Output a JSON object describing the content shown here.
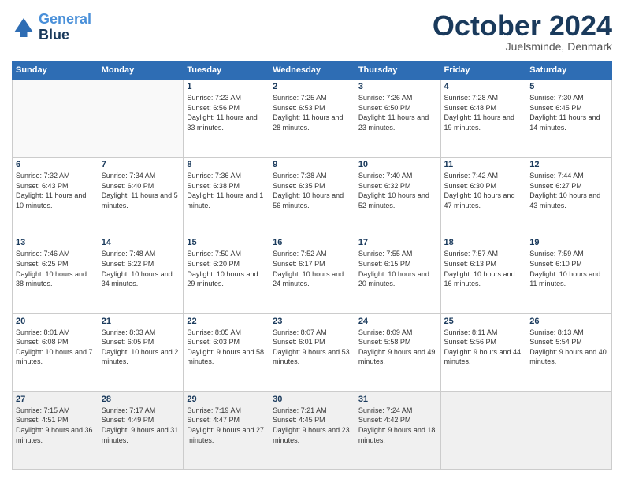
{
  "logo": {
    "line1": "General",
    "line2": "Blue"
  },
  "header": {
    "month": "October 2024",
    "location": "Juelsminde, Denmark"
  },
  "weekdays": [
    "Sunday",
    "Monday",
    "Tuesday",
    "Wednesday",
    "Thursday",
    "Friday",
    "Saturday"
  ],
  "weeks": [
    [
      {
        "day": "",
        "sunrise": "",
        "sunset": "",
        "daylight": ""
      },
      {
        "day": "",
        "sunrise": "",
        "sunset": "",
        "daylight": ""
      },
      {
        "day": "1",
        "sunrise": "Sunrise: 7:23 AM",
        "sunset": "Sunset: 6:56 PM",
        "daylight": "Daylight: 11 hours and 33 minutes."
      },
      {
        "day": "2",
        "sunrise": "Sunrise: 7:25 AM",
        "sunset": "Sunset: 6:53 PM",
        "daylight": "Daylight: 11 hours and 28 minutes."
      },
      {
        "day": "3",
        "sunrise": "Sunrise: 7:26 AM",
        "sunset": "Sunset: 6:50 PM",
        "daylight": "Daylight: 11 hours and 23 minutes."
      },
      {
        "day": "4",
        "sunrise": "Sunrise: 7:28 AM",
        "sunset": "Sunset: 6:48 PM",
        "daylight": "Daylight: 11 hours and 19 minutes."
      },
      {
        "day": "5",
        "sunrise": "Sunrise: 7:30 AM",
        "sunset": "Sunset: 6:45 PM",
        "daylight": "Daylight: 11 hours and 14 minutes."
      }
    ],
    [
      {
        "day": "6",
        "sunrise": "Sunrise: 7:32 AM",
        "sunset": "Sunset: 6:43 PM",
        "daylight": "Daylight: 11 hours and 10 minutes."
      },
      {
        "day": "7",
        "sunrise": "Sunrise: 7:34 AM",
        "sunset": "Sunset: 6:40 PM",
        "daylight": "Daylight: 11 hours and 5 minutes."
      },
      {
        "day": "8",
        "sunrise": "Sunrise: 7:36 AM",
        "sunset": "Sunset: 6:38 PM",
        "daylight": "Daylight: 11 hours and 1 minute."
      },
      {
        "day": "9",
        "sunrise": "Sunrise: 7:38 AM",
        "sunset": "Sunset: 6:35 PM",
        "daylight": "Daylight: 10 hours and 56 minutes."
      },
      {
        "day": "10",
        "sunrise": "Sunrise: 7:40 AM",
        "sunset": "Sunset: 6:32 PM",
        "daylight": "Daylight: 10 hours and 52 minutes."
      },
      {
        "day": "11",
        "sunrise": "Sunrise: 7:42 AM",
        "sunset": "Sunset: 6:30 PM",
        "daylight": "Daylight: 10 hours and 47 minutes."
      },
      {
        "day": "12",
        "sunrise": "Sunrise: 7:44 AM",
        "sunset": "Sunset: 6:27 PM",
        "daylight": "Daylight: 10 hours and 43 minutes."
      }
    ],
    [
      {
        "day": "13",
        "sunrise": "Sunrise: 7:46 AM",
        "sunset": "Sunset: 6:25 PM",
        "daylight": "Daylight: 10 hours and 38 minutes."
      },
      {
        "day": "14",
        "sunrise": "Sunrise: 7:48 AM",
        "sunset": "Sunset: 6:22 PM",
        "daylight": "Daylight: 10 hours and 34 minutes."
      },
      {
        "day": "15",
        "sunrise": "Sunrise: 7:50 AM",
        "sunset": "Sunset: 6:20 PM",
        "daylight": "Daylight: 10 hours and 29 minutes."
      },
      {
        "day": "16",
        "sunrise": "Sunrise: 7:52 AM",
        "sunset": "Sunset: 6:17 PM",
        "daylight": "Daylight: 10 hours and 24 minutes."
      },
      {
        "day": "17",
        "sunrise": "Sunrise: 7:55 AM",
        "sunset": "Sunset: 6:15 PM",
        "daylight": "Daylight: 10 hours and 20 minutes."
      },
      {
        "day": "18",
        "sunrise": "Sunrise: 7:57 AM",
        "sunset": "Sunset: 6:13 PM",
        "daylight": "Daylight: 10 hours and 16 minutes."
      },
      {
        "day": "19",
        "sunrise": "Sunrise: 7:59 AM",
        "sunset": "Sunset: 6:10 PM",
        "daylight": "Daylight: 10 hours and 11 minutes."
      }
    ],
    [
      {
        "day": "20",
        "sunrise": "Sunrise: 8:01 AM",
        "sunset": "Sunset: 6:08 PM",
        "daylight": "Daylight: 10 hours and 7 minutes."
      },
      {
        "day": "21",
        "sunrise": "Sunrise: 8:03 AM",
        "sunset": "Sunset: 6:05 PM",
        "daylight": "Daylight: 10 hours and 2 minutes."
      },
      {
        "day": "22",
        "sunrise": "Sunrise: 8:05 AM",
        "sunset": "Sunset: 6:03 PM",
        "daylight": "Daylight: 9 hours and 58 minutes."
      },
      {
        "day": "23",
        "sunrise": "Sunrise: 8:07 AM",
        "sunset": "Sunset: 6:01 PM",
        "daylight": "Daylight: 9 hours and 53 minutes."
      },
      {
        "day": "24",
        "sunrise": "Sunrise: 8:09 AM",
        "sunset": "Sunset: 5:58 PM",
        "daylight": "Daylight: 9 hours and 49 minutes."
      },
      {
        "day": "25",
        "sunrise": "Sunrise: 8:11 AM",
        "sunset": "Sunset: 5:56 PM",
        "daylight": "Daylight: 9 hours and 44 minutes."
      },
      {
        "day": "26",
        "sunrise": "Sunrise: 8:13 AM",
        "sunset": "Sunset: 5:54 PM",
        "daylight": "Daylight: 9 hours and 40 minutes."
      }
    ],
    [
      {
        "day": "27",
        "sunrise": "Sunrise: 7:15 AM",
        "sunset": "Sunset: 4:51 PM",
        "daylight": "Daylight: 9 hours and 36 minutes."
      },
      {
        "day": "28",
        "sunrise": "Sunrise: 7:17 AM",
        "sunset": "Sunset: 4:49 PM",
        "daylight": "Daylight: 9 hours and 31 minutes."
      },
      {
        "day": "29",
        "sunrise": "Sunrise: 7:19 AM",
        "sunset": "Sunset: 4:47 PM",
        "daylight": "Daylight: 9 hours and 27 minutes."
      },
      {
        "day": "30",
        "sunrise": "Sunrise: 7:21 AM",
        "sunset": "Sunset: 4:45 PM",
        "daylight": "Daylight: 9 hours and 23 minutes."
      },
      {
        "day": "31",
        "sunrise": "Sunrise: 7:24 AM",
        "sunset": "Sunset: 4:42 PM",
        "daylight": "Daylight: 9 hours and 18 minutes."
      },
      {
        "day": "",
        "sunrise": "",
        "sunset": "",
        "daylight": ""
      },
      {
        "day": "",
        "sunrise": "",
        "sunset": "",
        "daylight": ""
      }
    ]
  ]
}
